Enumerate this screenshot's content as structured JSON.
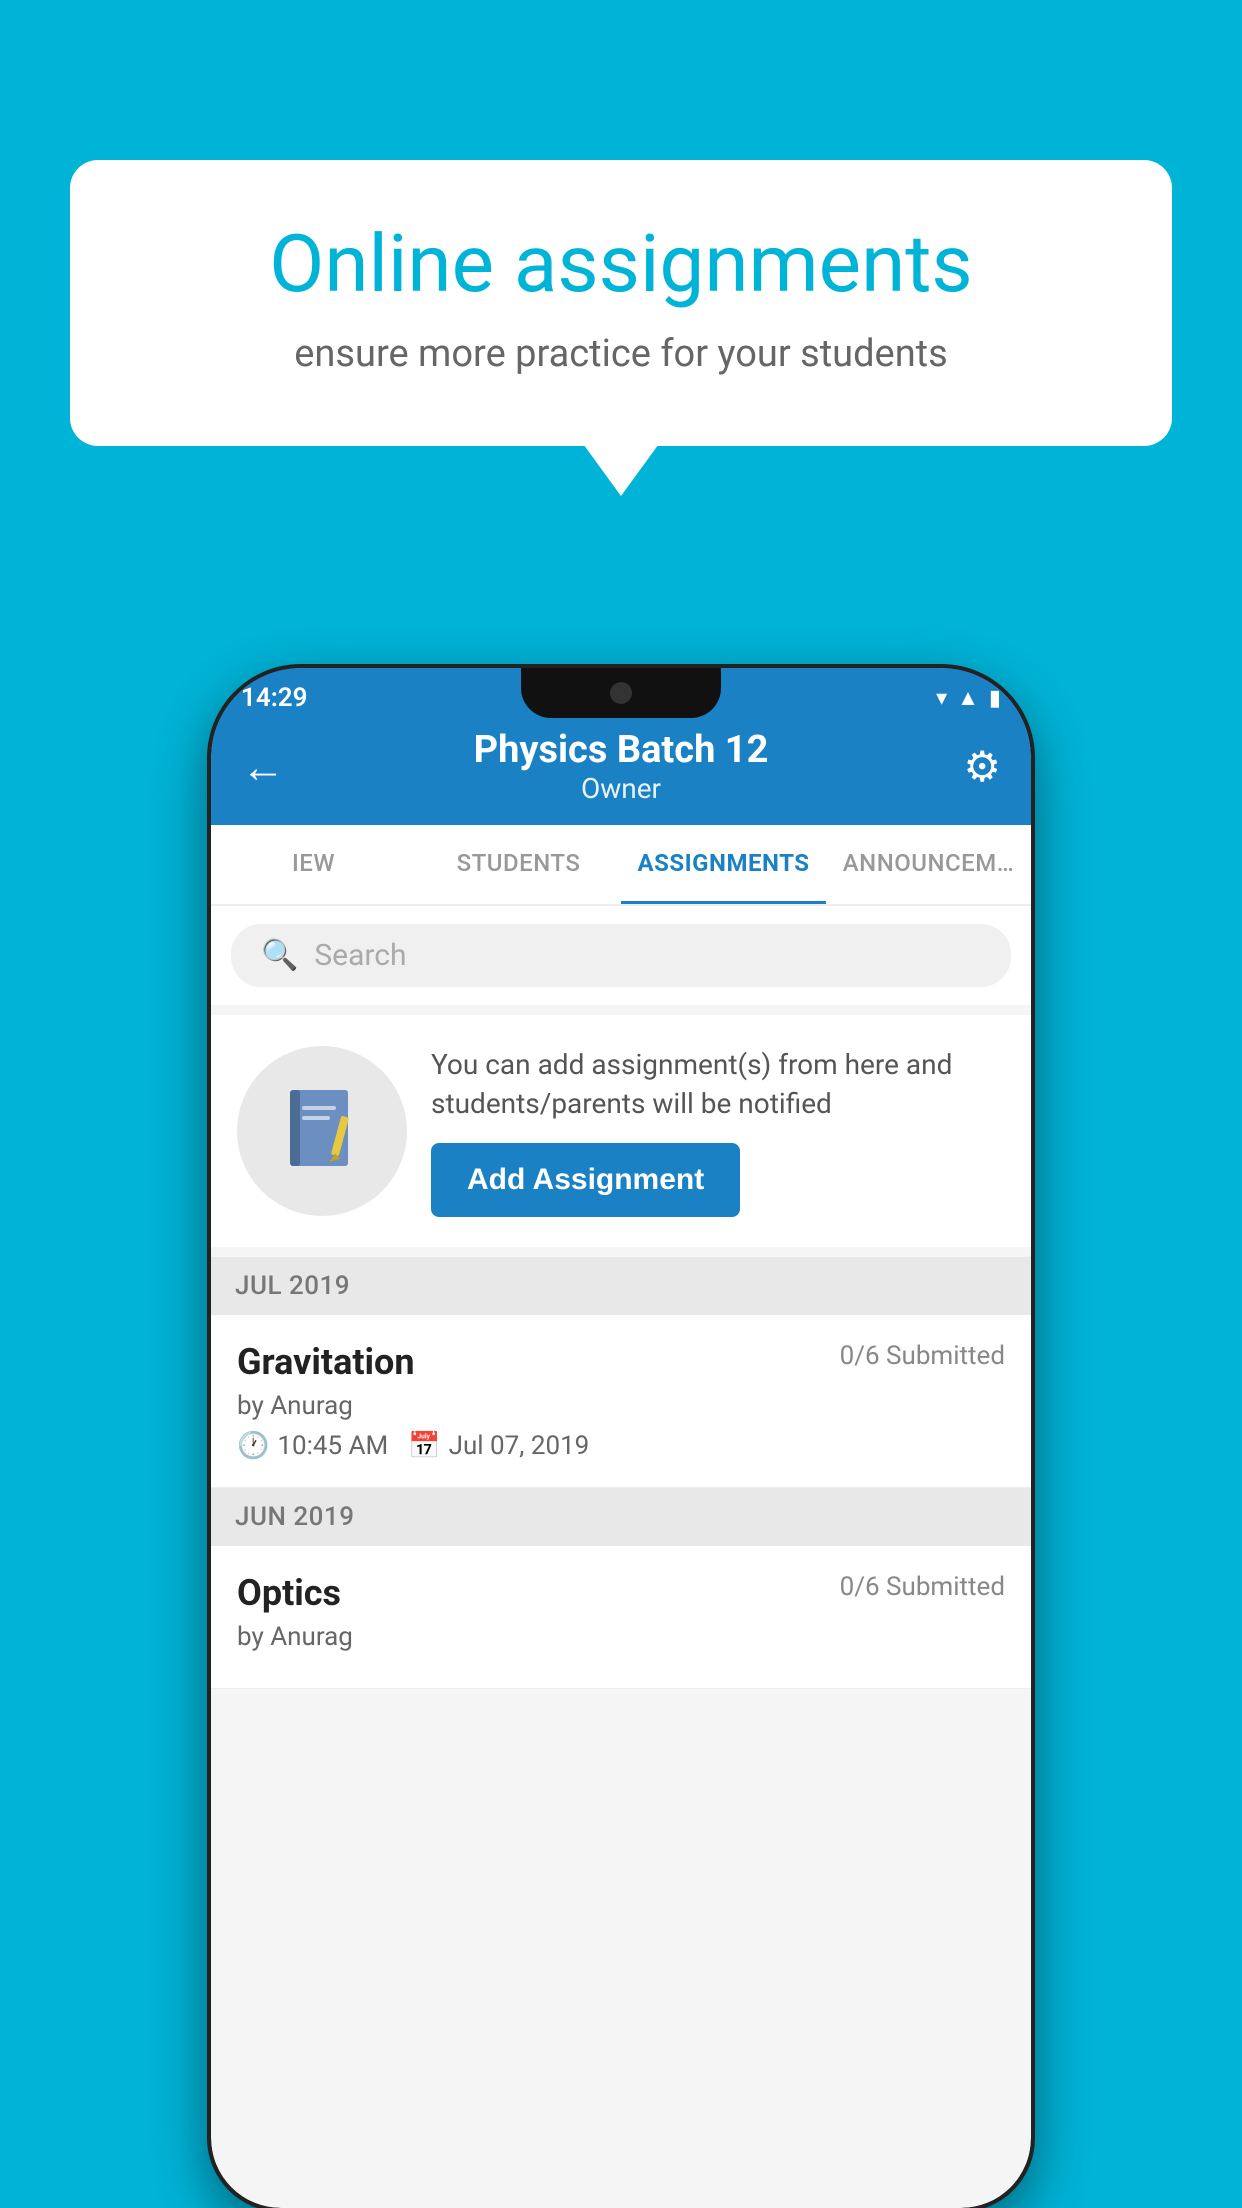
{
  "background": {
    "color": "#00B4D8"
  },
  "speech_bubble": {
    "title": "Online assignments",
    "subtitle": "ensure more practice for your students"
  },
  "status_bar": {
    "time": "14:29",
    "icons": [
      "wifi",
      "signal",
      "battery"
    ]
  },
  "header": {
    "title": "Physics Batch 12",
    "subtitle": "Owner",
    "back_label": "←",
    "gear_label": "⚙"
  },
  "tabs": [
    {
      "label": "IEW",
      "active": false
    },
    {
      "label": "STUDENTS",
      "active": false
    },
    {
      "label": "ASSIGNMENTS",
      "active": true
    },
    {
      "label": "ANNOUNCEM…",
      "active": false
    }
  ],
  "search": {
    "placeholder": "Search"
  },
  "promo": {
    "text": "You can add assignment(s) from here and students/parents will be notified",
    "button_label": "Add Assignment"
  },
  "sections": [
    {
      "month": "JUL 2019",
      "assignments": [
        {
          "name": "Gravitation",
          "submitted": "0/6 Submitted",
          "by": "by Anurag",
          "time": "10:45 AM",
          "date": "Jul 07, 2019"
        }
      ]
    },
    {
      "month": "JUN 2019",
      "assignments": [
        {
          "name": "Optics",
          "submitted": "0/6 Submitted",
          "by": "by Anurag",
          "time": "",
          "date": ""
        }
      ]
    }
  ]
}
